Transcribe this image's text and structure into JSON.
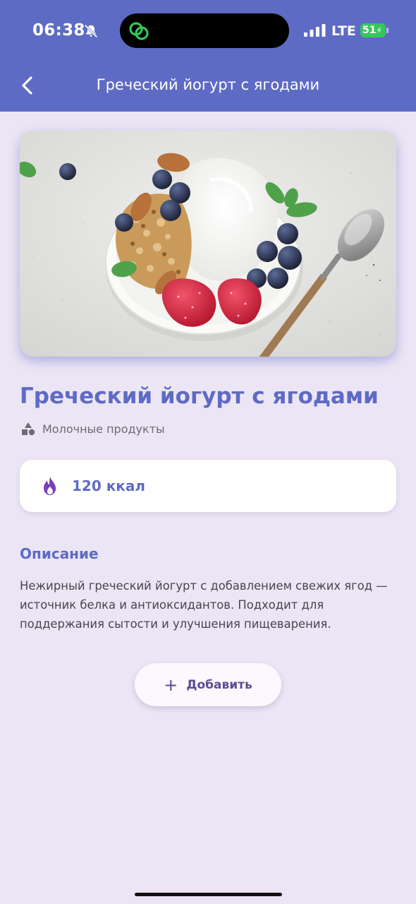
{
  "status_bar": {
    "time": "06:38",
    "network": "LTE",
    "battery": "51"
  },
  "app_bar": {
    "title": "Греческий йогурт с ягодами"
  },
  "product": {
    "title": "Греческий йогурт с ягодами",
    "category": "Молочные продукты",
    "calories": "120 ккал"
  },
  "description": {
    "heading": "Описание",
    "text": "Нежирный греческий йогурт с добавлением свежих ягод — источник белка и антиоксидантов. Подходит для поддержания сытости и улучшения пищеварения."
  },
  "actions": {
    "add_label": "Добавить"
  },
  "colors": {
    "primary": "#5E6BC4",
    "background": "#ECE5F5",
    "fire_icon": "#7A3FB8",
    "battery_green": "#34C759"
  },
  "icons": {
    "back": "chevron-left-icon",
    "bell": "bell-slash-icon",
    "category": "shapes-icon",
    "calories": "fire-icon",
    "add": "plus-icon"
  }
}
